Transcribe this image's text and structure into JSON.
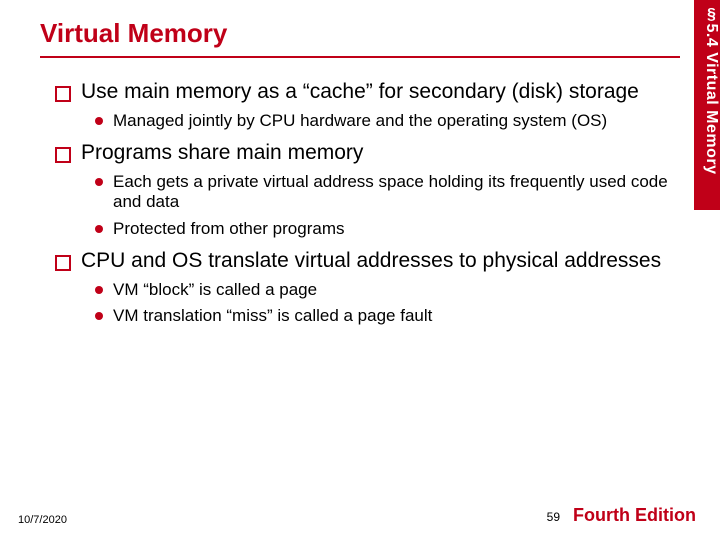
{
  "chapter_tab": "§5.4 Virtual Memory",
  "title": "Virtual Memory",
  "bullets": [
    {
      "text": "Use main memory as a “cache” for secondary (disk) storage",
      "sub": [
        "Managed jointly by CPU hardware and the operating system (OS)"
      ]
    },
    {
      "text": "Programs share main memory",
      "sub": [
        "Each gets a private virtual address space holding its frequently used code and data",
        "Protected from other programs"
      ]
    },
    {
      "text": "CPU and OS translate virtual addresses to physical addresses",
      "sub": [
        "VM “block” is called a page",
        "VM translation “miss” is called a page fault"
      ]
    }
  ],
  "footer": {
    "date": "10/7/2020",
    "page": "59",
    "edition": "Fourth Edition"
  }
}
